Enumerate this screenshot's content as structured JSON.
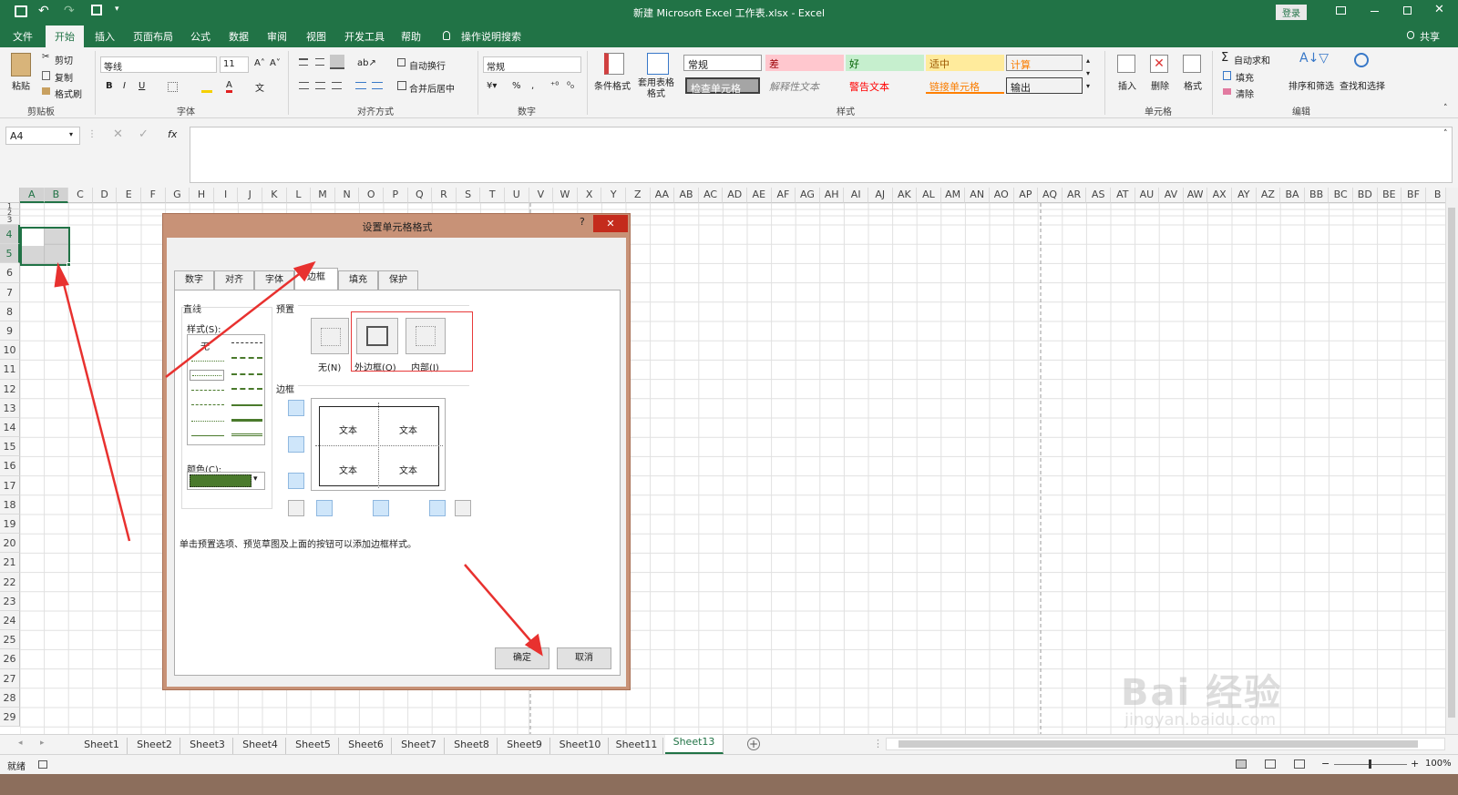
{
  "window": {
    "title": "新建 Microsoft Excel 工作表.xlsx  -  Excel",
    "login": "登录"
  },
  "menu": {
    "items": [
      "文件",
      "开始",
      "插入",
      "页面布局",
      "公式",
      "数据",
      "审阅",
      "视图",
      "开发工具",
      "帮助"
    ],
    "tell_me": "操作说明搜索",
    "share": "共享"
  },
  "ribbon": {
    "clipboard": {
      "paste": "粘贴",
      "cut": "剪切",
      "copy": "复制",
      "format_painter": "格式刷",
      "label": "剪贴板"
    },
    "font": {
      "name": "等线",
      "size": "11",
      "label": "字体",
      "bold": "B",
      "italic": "I",
      "underline": "U"
    },
    "alignment": {
      "wrap": "自动换行",
      "merge": "合并后居中",
      "label": "对齐方式"
    },
    "number": {
      "format": "常规",
      "label": "数字",
      "percent": "%"
    },
    "styles": {
      "conditional": "条件格式",
      "table": "套用表格格式",
      "label": "样式",
      "cells": {
        "normal": "常规",
        "bad": "差",
        "good": "好",
        "neutral": "适中",
        "calc": "计算",
        "check": "检查单元格",
        "explanatory": "解释性文本",
        "warning": "警告文本",
        "linked": "链接单元格",
        "output": "输出"
      }
    },
    "cells": {
      "insert": "插入",
      "delete": "删除",
      "format": "格式",
      "label": "单元格"
    },
    "editing": {
      "autosum": "自动求和",
      "fill": "填充",
      "clear": "清除",
      "sort": "排序和筛选",
      "find": "查找和选择",
      "label": "编辑"
    }
  },
  "formula": {
    "namebox": "A4",
    "fx": "fx"
  },
  "columns": [
    "A",
    "B",
    "C",
    "D",
    "E",
    "F",
    "G",
    "H",
    "I",
    "J",
    "K",
    "L",
    "M",
    "N",
    "O",
    "P",
    "Q",
    "R",
    "S",
    "T",
    "U",
    "V",
    "W",
    "X",
    "Y",
    "Z",
    "AA",
    "AB",
    "AC",
    "AD",
    "AE",
    "AF",
    "AG",
    "AH",
    "AI",
    "AJ",
    "AK",
    "AL",
    "AM",
    "AN",
    "AO",
    "AP",
    "AQ",
    "AR",
    "AS",
    "AT",
    "AU",
    "AV",
    "AW",
    "AX",
    "AY",
    "AZ",
    "BA",
    "BB",
    "BC",
    "BD",
    "BE",
    "BF",
    "B"
  ],
  "rows": [
    "1",
    "2",
    "3",
    "4",
    "5",
    "6",
    "7",
    "8",
    "9",
    "10",
    "11",
    "12",
    "13",
    "14",
    "15",
    "16",
    "17",
    "18",
    "19",
    "20",
    "21",
    "22",
    "23",
    "24",
    "25",
    "26",
    "27",
    "28",
    "29"
  ],
  "dialog": {
    "title": "设置单元格格式",
    "help": "?",
    "close": "✕",
    "tabs": [
      "数字",
      "对齐",
      "字体",
      "边框",
      "填充",
      "保护"
    ],
    "line_group": "直线",
    "style_label": "样式(S):",
    "none_style": "无",
    "color_label": "颜色(C):",
    "presets_label": "预置",
    "preset_none": "无(N)",
    "preset_outline": "外边框(O)",
    "preset_inside": "内部(I)",
    "border_label": "边框",
    "preview_text": [
      "文本",
      "文本",
      "文本",
      "文本"
    ],
    "hint": "单击预置选项、预览草图及上面的按钮可以添加边框样式。",
    "ok": "确定",
    "cancel": "取消",
    "color_value": "#4a7a2c"
  },
  "sheets": [
    "Sheet1",
    "Sheet2",
    "Sheet3",
    "Sheet4",
    "Sheet5",
    "Sheet6",
    "Sheet7",
    "Sheet8",
    "Sheet9",
    "Sheet10",
    "Sheet11",
    "Sheet13"
  ],
  "active_sheet": "Sheet13",
  "status": {
    "ready": "就绪",
    "zoom": "100%"
  },
  "watermark": {
    "text": "Bai 经验",
    "sub": "jingyan.baidu.com"
  },
  "colors": {
    "excel_green": "#217346",
    "arrow_red": "#e8312f",
    "dialog_frame": "#c89277"
  }
}
